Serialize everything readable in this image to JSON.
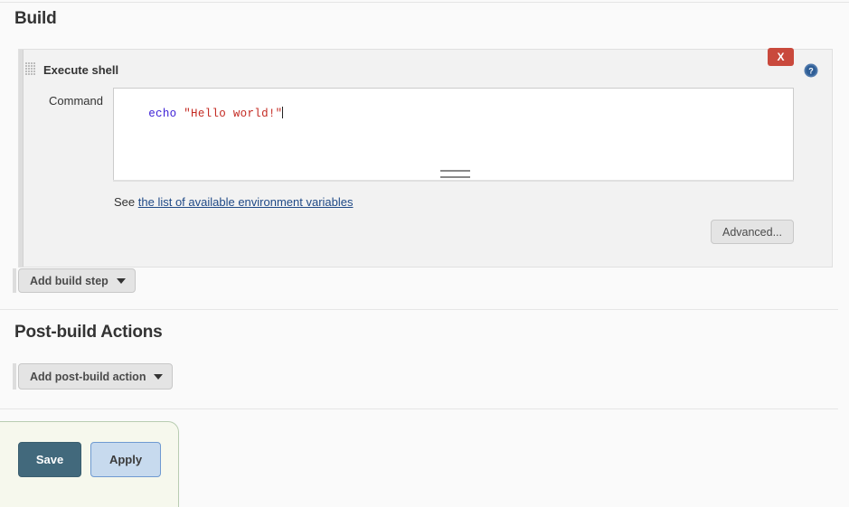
{
  "page": {
    "build_section_title": "Build",
    "postbuild_section_title": "Post-build Actions"
  },
  "build_step": {
    "name": "Execute shell",
    "drag_handle_icon": "grip-dots-icon",
    "close_label": "X",
    "help_icon": "help-circle-icon",
    "command_label": "Command",
    "command_value": "echo \"Hello world!\"",
    "command_tokens": {
      "keyword": "echo",
      "space": " ",
      "string": "\"Hello world!\""
    },
    "help_text_prefix": "See",
    "help_link_text": "the list of available environment variables",
    "advanced_label": "Advanced...",
    "resize_grip_icon": "resize-grip-icon"
  },
  "actions": {
    "add_build_step_label": "Add build step",
    "add_post_build_label": "Add post-build action",
    "dropdown_icon": "chevron-down-icon"
  },
  "save_bar": {
    "save_label": "Save",
    "apply_label": "Apply"
  },
  "colors": {
    "save_button": "#42697c",
    "apply_button": "#c7daee",
    "apply_border": "#6f9ad1",
    "close_button": "#c9493c",
    "link": "#204a87",
    "code_keyword": "#3b1fd6",
    "code_string": "#c42a22",
    "panel_bg": "#f2f2f2",
    "save_bar_bg": "#f6f8ed",
    "save_bar_border": "#b9cdb2"
  }
}
